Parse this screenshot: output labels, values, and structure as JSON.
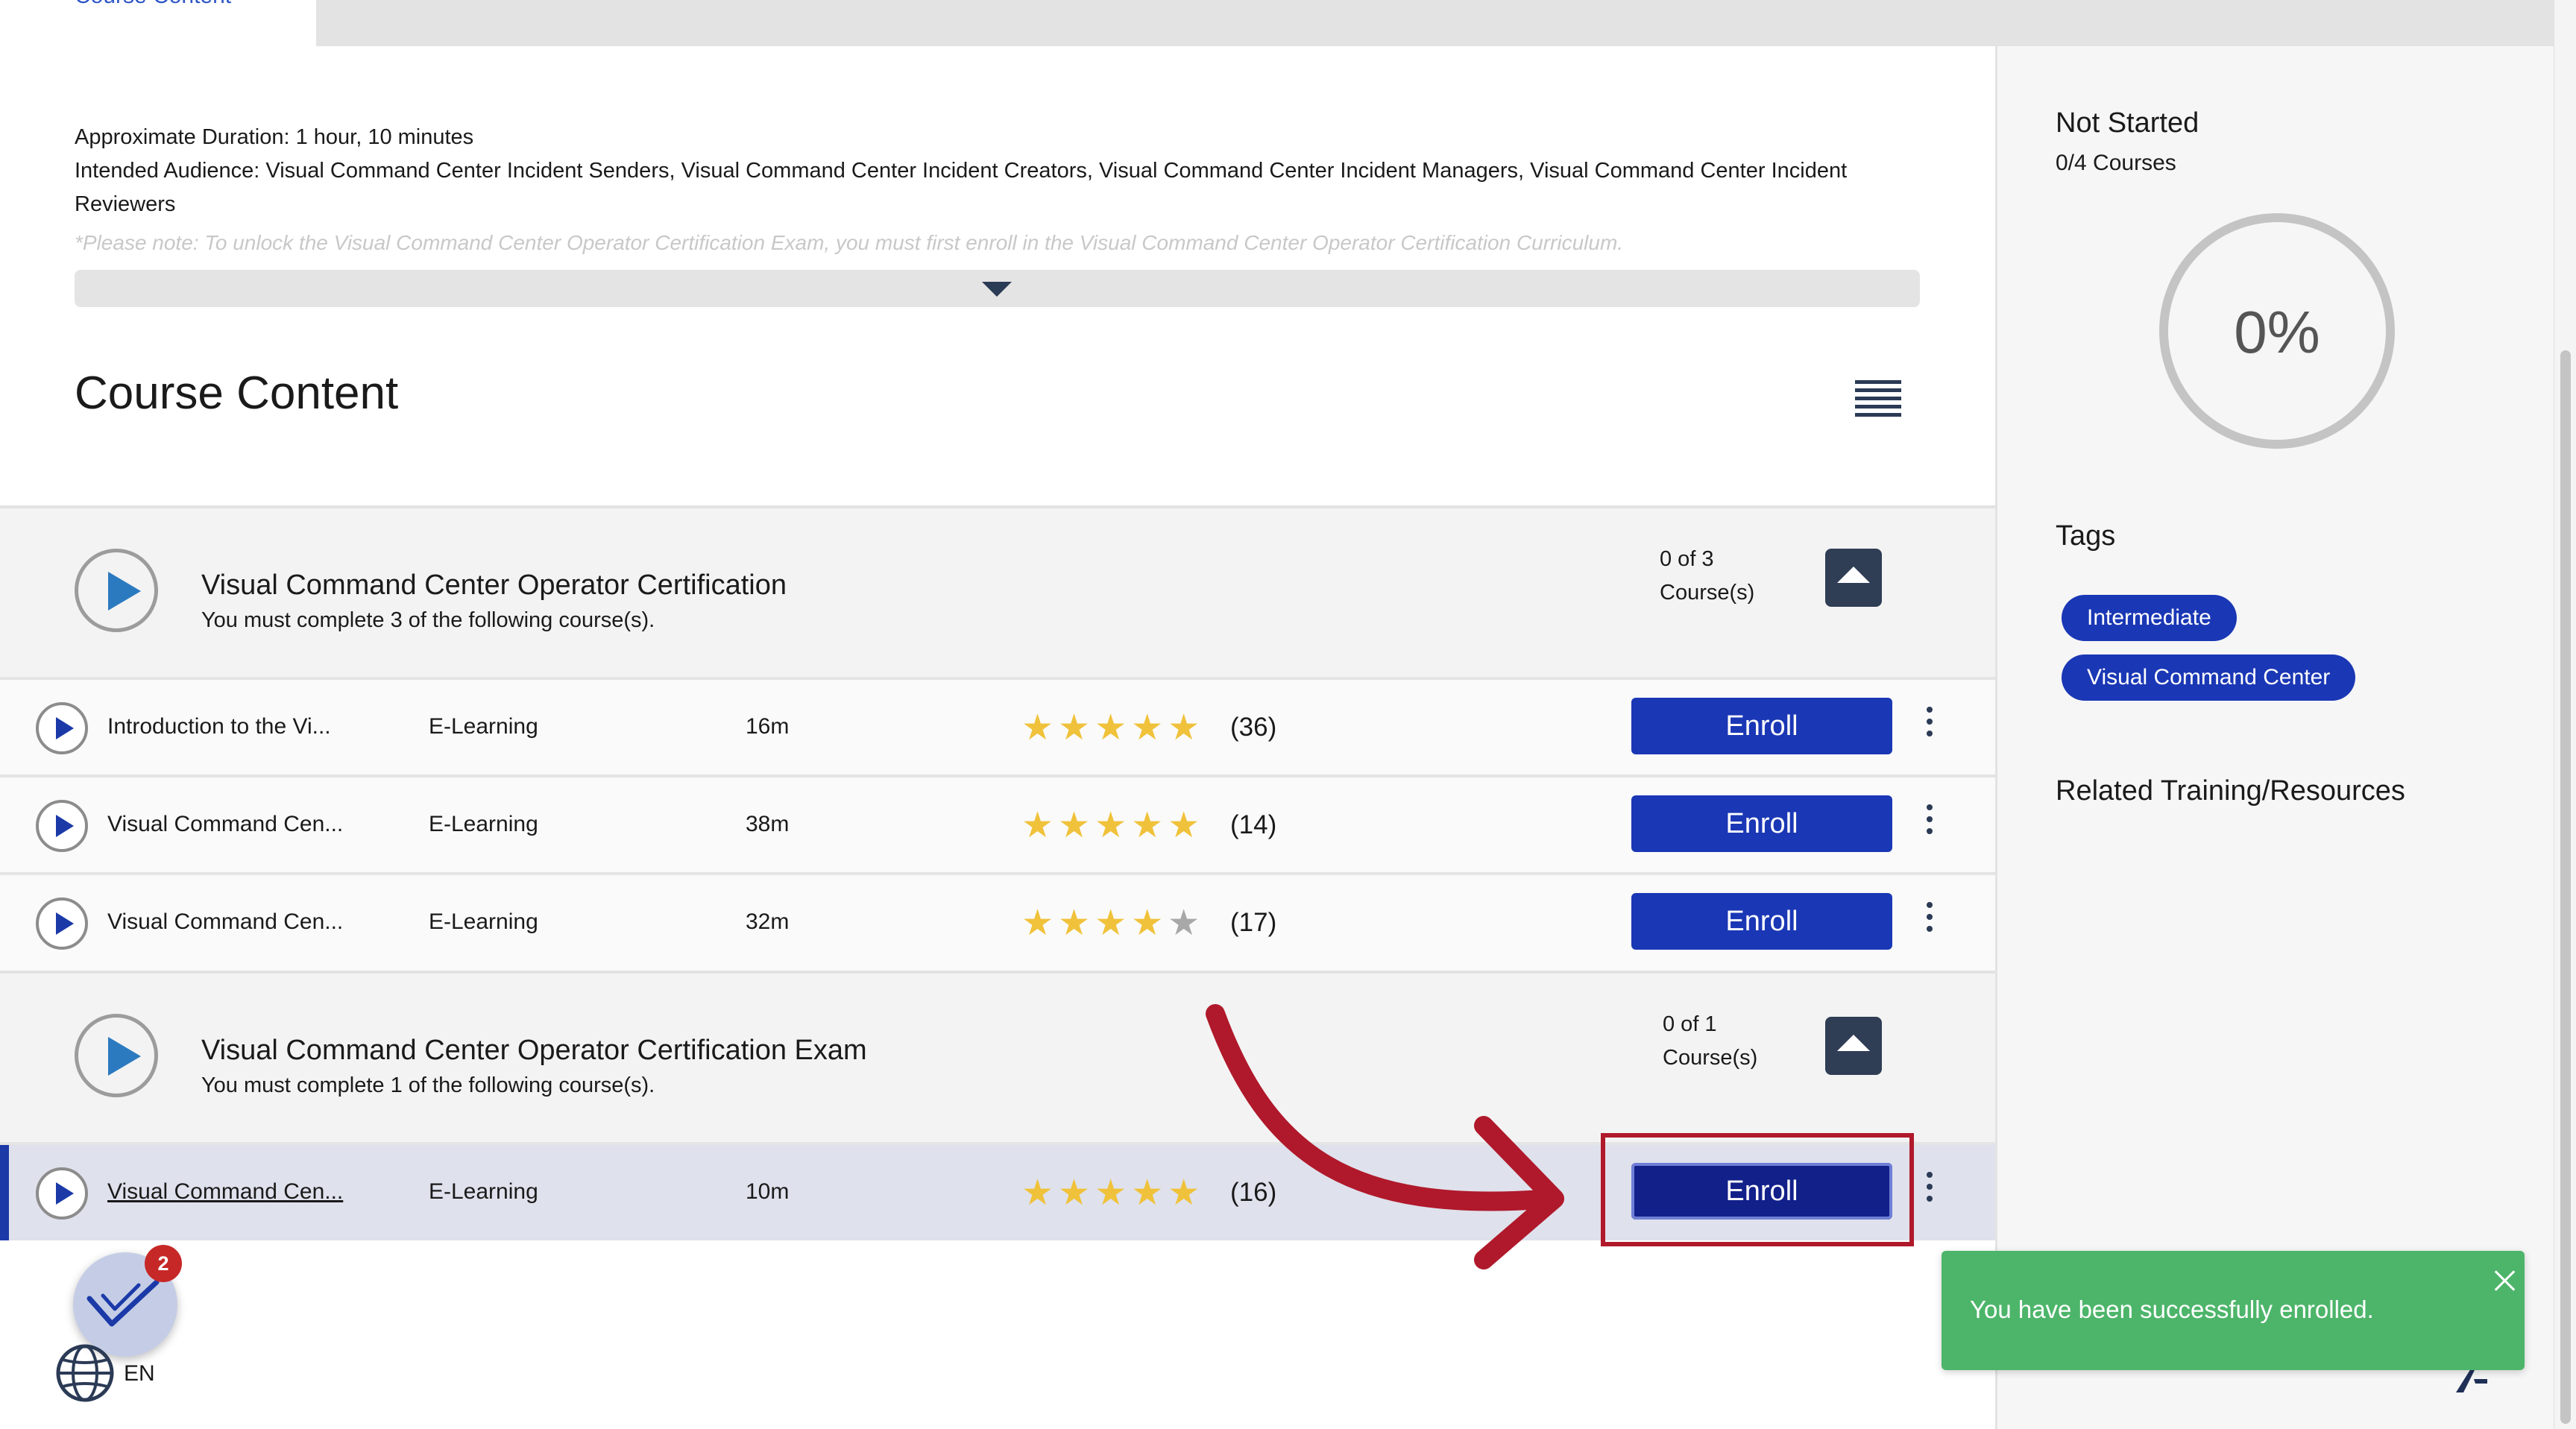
{
  "tabs": {
    "active_label": "Course Content"
  },
  "description": {
    "duration": "Approximate Duration: 1 hour, 10 minutes",
    "audience": "Intended Audience: Visual Command Center Incident Senders, Visual Command Center Incident Creators, Visual Command Center Incident Managers, Visual Command Center Incident Reviewers",
    "note": "*Please note: To unlock the Visual Command Center Operator Certification Exam, you must first enroll in the Visual Command Center Operator Certification Curriculum."
  },
  "content": {
    "title": "Course Content",
    "sections": [
      {
        "title": "Visual Command Center Operator Certification",
        "subtitle": "You must complete 3 of the following course(s).",
        "count_line1": "0 of 3",
        "count_line2": "Course(s)",
        "rows": [
          {
            "name": "Introduction to the Vi...",
            "type": "E-Learning",
            "duration": "16m",
            "stars": 5,
            "rating": "(36)",
            "enroll": "Enroll"
          },
          {
            "name": "Visual Command Cen...",
            "type": "E-Learning",
            "duration": "38m",
            "stars": 5,
            "rating": "(14)",
            "enroll": "Enroll"
          },
          {
            "name": "Visual Command Cen...",
            "type": "E-Learning",
            "duration": "32m",
            "stars": 4,
            "rating": "(17)",
            "enroll": "Enroll"
          }
        ]
      },
      {
        "title": "Visual Command Center Operator Certification Exam",
        "subtitle": "You must complete 1 of the following course(s).",
        "count_line1": "0 of 1",
        "count_line2": "Course(s)",
        "rows": [
          {
            "name": "Visual Command Cen...",
            "type": "E-Learning",
            "duration": "10m",
            "stars": 5,
            "rating": "(16)",
            "enroll": "Enroll"
          }
        ]
      }
    ]
  },
  "sidebar": {
    "status": "Not Started",
    "courses": "0/4 Courses",
    "progress_percent": "0%",
    "progress_value": 0,
    "tags_heading": "Tags",
    "tags": [
      "Intermediate",
      "Visual Command Center"
    ],
    "related_heading": "Related Training/Resources"
  },
  "widgets": {
    "badge_count": "2",
    "language": "EN"
  },
  "toast": {
    "message": "You have been successfully enrolled."
  },
  "colors": {
    "primary": "#1a37b5",
    "primary_active": "#12208a",
    "annotation": "#b0192b",
    "toast": "#4db56a",
    "star": "#f0c23b"
  },
  "icons": {
    "section_play": "play-circle-icon",
    "row_play": "play-icon",
    "list_view": "list-view-icon",
    "collapse": "chevron-up-icon",
    "kebab": "kebab-menu-icon",
    "expand": "chevron-down-icon",
    "badge": "checkmark-badge-icon",
    "globe": "globe-icon",
    "close": "close-icon"
  }
}
